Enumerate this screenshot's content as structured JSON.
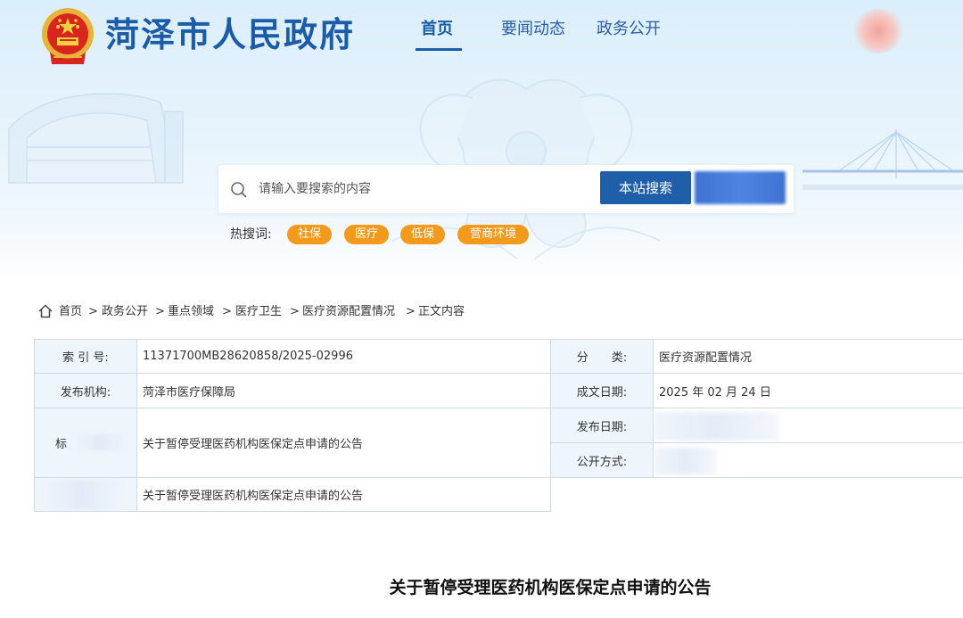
{
  "header": {
    "site_title": "菏泽市人民政府",
    "nav": [
      {
        "label": "首页",
        "active": true
      },
      {
        "label": "要闻动态",
        "active": false
      },
      {
        "label": "政务公开",
        "active": false
      }
    ]
  },
  "search": {
    "placeholder": "请输入要搜索的内容",
    "site_button": "本站搜索",
    "hot_label": "热搜词:",
    "hot_tags": [
      "社保",
      "医疗",
      "低保",
      "营商环境"
    ]
  },
  "breadcrumb": [
    "首页",
    "政务公开",
    "重点领域",
    "医疗卫生",
    "医疗资源配置情况",
    "正文内容"
  ],
  "info": {
    "index_label": "索 引 号:",
    "index_value": "11371700MB28620858/2025-02996",
    "category_label": "分　　类:",
    "category_value": "医疗资源配置情况",
    "org_label": "发布机构:",
    "org_value": "菏泽市医疗保障局",
    "written_date_label": "成文日期:",
    "written_date_value": "2025 年 02 月 24 日",
    "title_label": "标",
    "title_value": "关于暂停受理医药机构医保定点申请的公告",
    "publish_date_label": "发布日期:",
    "open_method_label": "公开方式:",
    "subject_value": "关于暂停受理医药机构医保定点申请的公告"
  },
  "article": {
    "title": "关于暂停受理医药机构医保定点申请的公告"
  },
  "colors": {
    "brand_blue": "#1b5ca8",
    "button_blue": "#1f5ea9",
    "hot_tag_orange": "#f39a1d",
    "label_bg": "#eef5fb"
  }
}
